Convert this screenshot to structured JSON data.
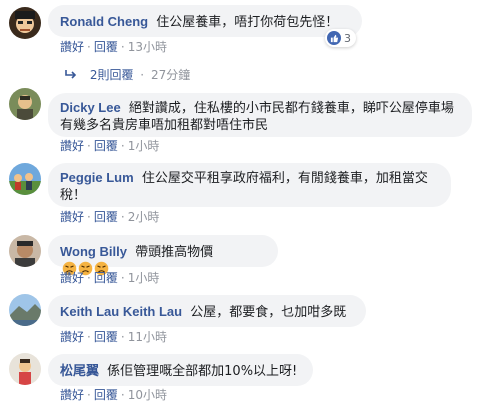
{
  "actions": {
    "like": "讚好",
    "reply": "回覆",
    "separator": "·"
  },
  "comments": [
    {
      "author": "Ronald Cheng",
      "text": "住公屋養車，唔打你荷包先怪！",
      "time": "13小時",
      "reactions": "3"
    },
    {
      "author": "Dicky Lee",
      "text": "絕對讚成，住私樓的小市民都冇錢養車，睇吓公屋停車場有幾多名貴房車唔加租都對唔住市民",
      "time": "1小時"
    },
    {
      "author": "Peggie Lum",
      "text": "住公屋交平租享政府福利，有閒錢養車，加租當交稅！",
      "time": "2小時"
    },
    {
      "author": "Wong Billy",
      "text": "帶頭推高物價",
      "time": "1小時",
      "emoji": "angry-face"
    },
    {
      "author": "Keith Lau Keith Lau",
      "text": "公屋，都要食，乜加咁多既",
      "time": "11小時"
    },
    {
      "author": "松尾翼",
      "text": "係佢管理嘅全部都加10%以上呀!",
      "time": "10小時"
    }
  ],
  "replies": {
    "label": "2則回覆",
    "time": "27分鐘",
    "icon": "reply-arrow-icon"
  },
  "colors": {
    "link": "#385898",
    "bubble": "#f2f3f5",
    "like_badge": "#4267b2"
  }
}
